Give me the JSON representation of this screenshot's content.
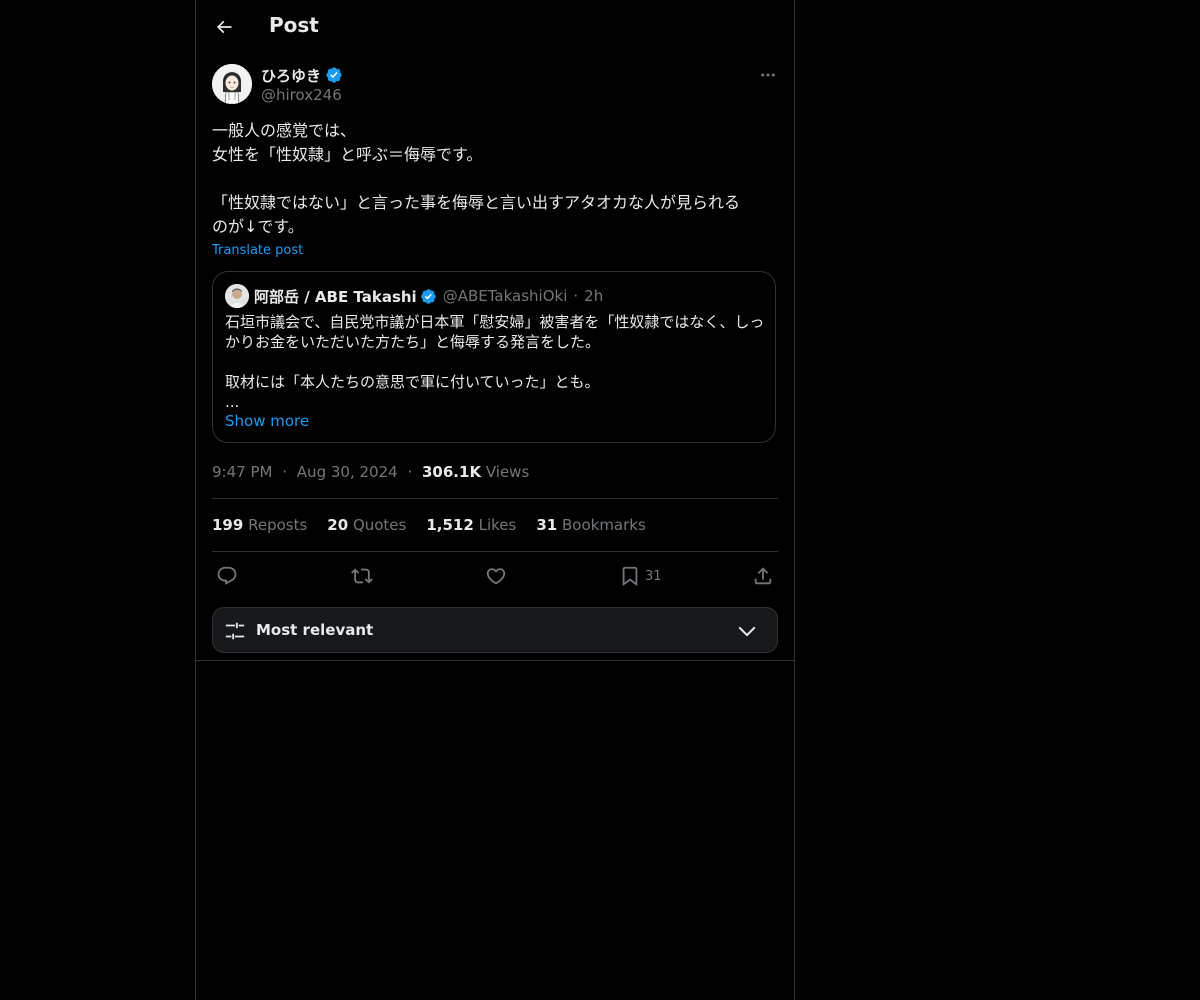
{
  "header": {
    "title": "Post",
    "back_icon": "arrow-left-icon"
  },
  "post": {
    "author": {
      "display_name": "ひろゆき",
      "handle": "@hirox246",
      "verified": true
    },
    "text_lines": [
      "一般人の感覚では、",
      "女性を「性奴隷」と呼ぶ＝侮辱です。",
      "",
      "「性奴隷ではない」と言った事を侮辱と言い出すアタオカな人が見られる",
      "のが↓です。"
    ],
    "translate_label": "Translate post",
    "quote": {
      "display_name": "阿部岳 / ABE Takashi",
      "handle": "@ABETakashiOki",
      "separator": "·",
      "time": "2h",
      "text_lines": [
        "石垣市議会で、自民党市議が日本軍「慰安婦」被害者を「性奴隷ではなく、しっ",
        "かりお金をいただいた方たち」と侮辱する発言をした。",
        "",
        "取材には「本人たちの意思で軍に付いていった」とも。",
        "..."
      ],
      "show_more": "Show more"
    },
    "time": "9:47 PM",
    "date": "Aug 30, 2024",
    "separator": "·",
    "views_count": "306.1K",
    "views_label": "Views",
    "stats": {
      "reposts_count": "199",
      "reposts_label": "Reposts",
      "quotes_count": "20",
      "quotes_label": "Quotes",
      "likes_count": "1,512",
      "likes_label": "Likes",
      "bookmarks_count": "31",
      "bookmarks_label": "Bookmarks"
    },
    "actions": {
      "reply_icon": "reply-icon",
      "repost_icon": "repost-icon",
      "like_icon": "heart-icon",
      "bookmark_icon": "bookmark-icon",
      "bookmark_count": "31",
      "share_icon": "share-icon"
    }
  },
  "replies_sort": {
    "label": "Most relevant",
    "icon": "sliders-icon",
    "chevron": "chevron-down-icon"
  },
  "colors": {
    "background": "#000000",
    "text": "#e7e9ea",
    "secondary": "#71767b",
    "accent": "#1d9bf0",
    "border": "#2f3336"
  }
}
